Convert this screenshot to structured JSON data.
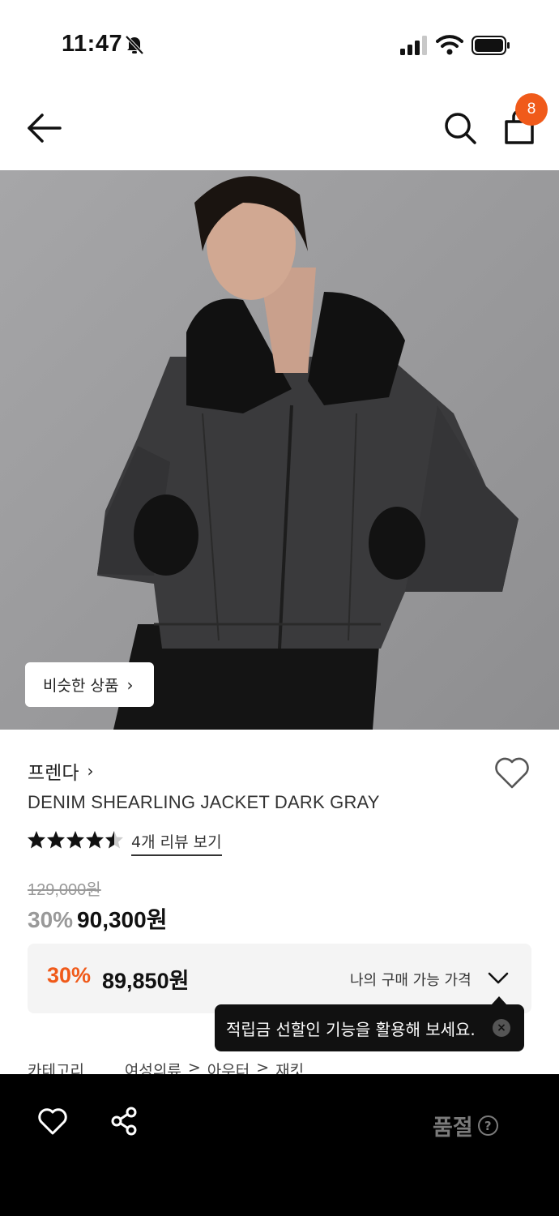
{
  "status_bar": {
    "time": "11:47"
  },
  "header": {
    "cart_count": "8"
  },
  "product": {
    "similar_button": "비슷한 상품",
    "brand": "프렌다",
    "title": "DENIM SHEARLING JACKET DARK GRAY",
    "rating": 4.5,
    "reviews_link": "4개 리뷰 보기",
    "original_price": "129,000원",
    "discount": "30%",
    "price": "90,300원"
  },
  "my_price": {
    "discount": "30%",
    "price": "89,850원",
    "label": "나의 구매 가능 가격"
  },
  "tooltip": {
    "text": "적립금 선할인 기능을 활용해 보세요."
  },
  "category": {
    "label": "카테고리",
    "path": [
      "여성의류",
      ">",
      "아우터",
      ">",
      "재킷"
    ]
  },
  "bottom_bar": {
    "status": "품절"
  },
  "colors": {
    "accent": "#f05a1a",
    "bottom_bar": "#000000"
  }
}
